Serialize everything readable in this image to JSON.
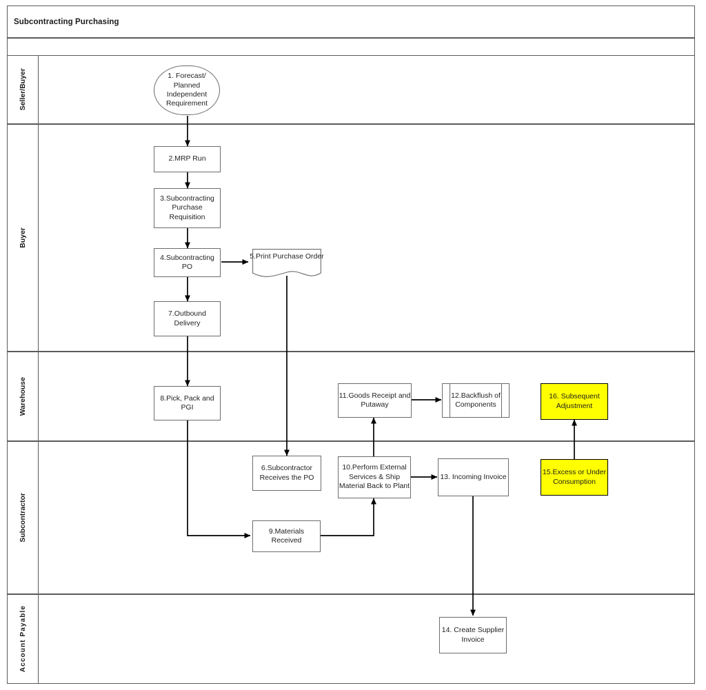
{
  "diagram": {
    "title": "Subcontracting Purchasing",
    "type": "swimlane-flowchart",
    "highlight_color": "#FFFF00",
    "border_color": "#5a5a5a",
    "node_border_color": "#6b6b6b"
  },
  "lanes": [
    {
      "id": "lane-seller-buyer",
      "label": "Seller/Buyer"
    },
    {
      "id": "lane-buyer",
      "label": "Buyer"
    },
    {
      "id": "lane-warehouse",
      "label": "Warehouse"
    },
    {
      "id": "lane-subcontractor",
      "label": "Subcontractor"
    },
    {
      "id": "lane-account-payable",
      "label": "Account Payable"
    }
  ],
  "nodes": [
    {
      "id": "node-1",
      "number": "1.",
      "label": "1. Forecast/ Planned Independent Requirement",
      "shape": "terminator",
      "lane": "Seller/Buyer",
      "highlight": false
    },
    {
      "id": "node-2",
      "number": "2.",
      "label": "2.MRP Run",
      "shape": "process",
      "lane": "Buyer",
      "highlight": false
    },
    {
      "id": "node-3",
      "number": "3.",
      "label": "3.Subcontracting Purchase Requisition",
      "shape": "process",
      "lane": "Buyer",
      "highlight": false
    },
    {
      "id": "node-4",
      "number": "4.",
      "label": "4.Subcontracting PO",
      "shape": "process",
      "lane": "Buyer",
      "highlight": false
    },
    {
      "id": "node-5",
      "number": "5.",
      "label": "5.Print Purchase Order",
      "shape": "document",
      "lane": "Buyer",
      "highlight": false
    },
    {
      "id": "node-6",
      "number": "6.",
      "label": "6.Subcontractor Receives the PO",
      "shape": "process",
      "lane": "Subcontractor",
      "highlight": false
    },
    {
      "id": "node-7",
      "number": "7.",
      "label": "7.Outbound Delivery",
      "shape": "process",
      "lane": "Buyer",
      "highlight": false
    },
    {
      "id": "node-8",
      "number": "8.",
      "label": "8.Pick, Pack and PGI",
      "shape": "process",
      "lane": "Warehouse",
      "highlight": false
    },
    {
      "id": "node-9",
      "number": "9.",
      "label": "9.Materials Received",
      "shape": "process",
      "lane": "Subcontractor",
      "highlight": false
    },
    {
      "id": "node-10",
      "number": "10.",
      "label": "10.Perform External Services & Ship Material Back to Plant",
      "shape": "process",
      "lane": "Subcontractor",
      "highlight": false
    },
    {
      "id": "node-11",
      "number": "11.",
      "label": "11.Goods Receipt and Putaway",
      "shape": "process",
      "lane": "Warehouse",
      "highlight": false
    },
    {
      "id": "node-12",
      "number": "12.",
      "label": "12.Backflush of Components",
      "shape": "predefined-process",
      "lane": "Warehouse",
      "highlight": false
    },
    {
      "id": "node-13",
      "number": "13.",
      "label": "13. Incoming Invoice",
      "shape": "process",
      "lane": "Subcontractor",
      "highlight": false
    },
    {
      "id": "node-14",
      "number": "14.",
      "label": "14. Create Supplier Invoice",
      "shape": "process",
      "lane": "Account Payable",
      "highlight": false
    },
    {
      "id": "node-15",
      "number": "15.",
      "label": "15.Excess or Under Consumption",
      "shape": "process",
      "lane": "Subcontractor",
      "highlight": true
    },
    {
      "id": "node-16",
      "number": "16.",
      "label": "16. Subsequent Adjustment",
      "shape": "process",
      "lane": "Warehouse",
      "highlight": true
    }
  ],
  "connections": [
    {
      "from": "node-1",
      "to": "node-2"
    },
    {
      "from": "node-2",
      "to": "node-3"
    },
    {
      "from": "node-3",
      "to": "node-4"
    },
    {
      "from": "node-4",
      "to": "node-5"
    },
    {
      "from": "node-4",
      "to": "node-7"
    },
    {
      "from": "node-5",
      "to": "node-6"
    },
    {
      "from": "node-7",
      "to": "node-8"
    },
    {
      "from": "node-8",
      "to": "node-9"
    },
    {
      "from": "node-9",
      "to": "node-10"
    },
    {
      "from": "node-10",
      "to": "node-11"
    },
    {
      "from": "node-10",
      "to": "node-13"
    },
    {
      "from": "node-11",
      "to": "node-12"
    },
    {
      "from": "node-13",
      "to": "node-14"
    },
    {
      "from": "node-15",
      "to": "node-16"
    }
  ]
}
